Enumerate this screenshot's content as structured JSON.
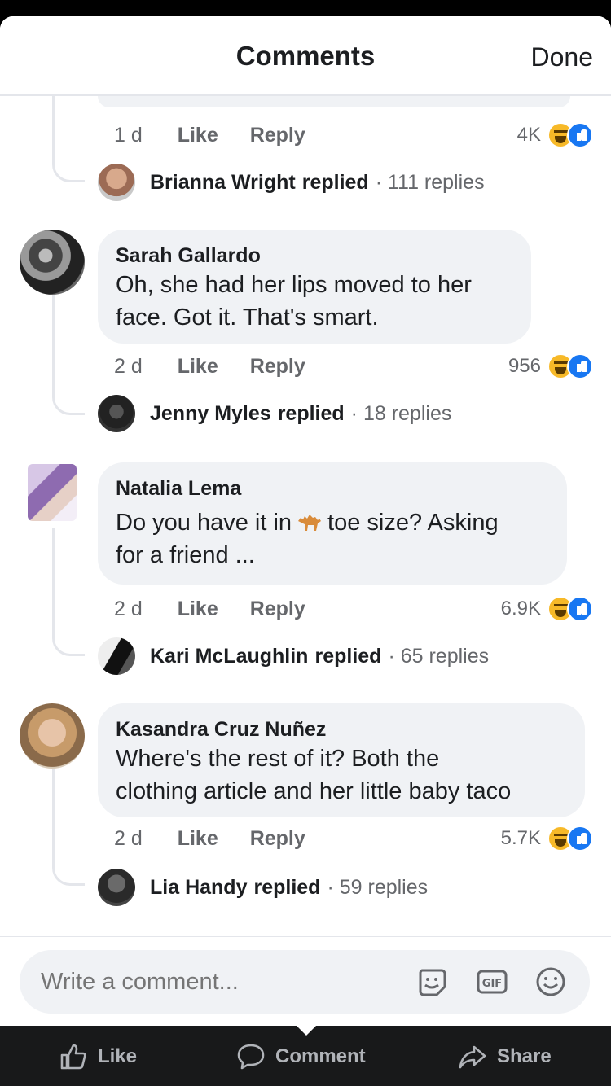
{
  "header": {
    "title": "Comments",
    "done_label": "Done"
  },
  "top_comment": {
    "time": "1 d",
    "like_label": "Like",
    "reply_label": "Reply",
    "reaction_count": "4K"
  },
  "comments": [
    {
      "author": "Brianna Wright",
      "replied_text": "replied",
      "reply_count": "· 111 replies"
    },
    {
      "author": "Sarah Gallardo",
      "text": "Oh, she had her lips moved to her face. Got it. That's smart.",
      "text_line1": "Oh, she had her lips moved to her",
      "text_line2": "face. Got it. That's smart.",
      "time": "2 d",
      "like_label": "Like",
      "reply_label": "Reply",
      "reaction_count": "956",
      "reply_author": "Jenny Myles",
      "replied_text": "replied",
      "reply_count": "· 18 replies"
    },
    {
      "author": "Natalia Lema",
      "text_before_emoji": "Do you have it in",
      "text_after_emoji": "toe size? Asking",
      "text_line2": "for a friend ...",
      "emoji": "camel",
      "time": "2 d",
      "like_label": "Like",
      "reply_label": "Reply",
      "reaction_count": "6.9K",
      "reply_author": "Kari McLaughlin",
      "replied_text": "replied",
      "reply_count": "· 65 replies"
    },
    {
      "author": "Kasandra Cruz Nuñez",
      "text_line1": "Where's the rest of it? Both the",
      "text_line2": "clothing article and her little baby taco",
      "time": "2 d",
      "like_label": "Like",
      "reply_label": "Reply",
      "reaction_count": "5.7K",
      "reply_author": "Lia Handy",
      "replied_text": "replied",
      "reply_count": "· 59 replies"
    }
  ],
  "composer": {
    "placeholder": "Write a comment..."
  },
  "bottom_bar": {
    "like_label": "Like",
    "comment_label": "Comment",
    "share_label": "Share"
  },
  "colors": {
    "bubble": "#f0f2f5",
    "meta_text": "#65676b",
    "like_blue": "#1877f2",
    "haha_yellow": "#f7b928"
  }
}
